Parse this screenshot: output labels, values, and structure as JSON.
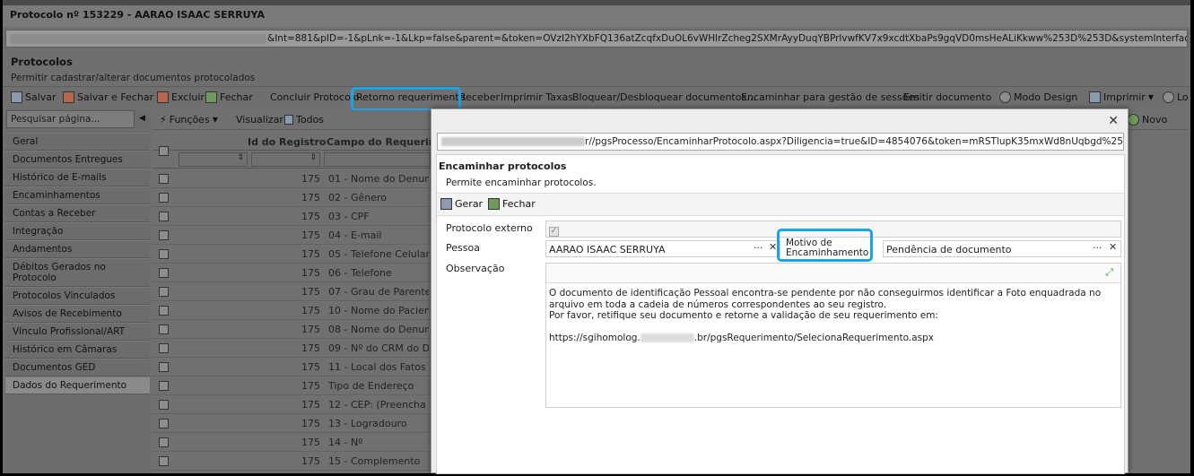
{
  "window": {
    "title": "Protocolo nº 153229 - AARAO ISAAC SERRUYA",
    "url_visible": "&Int=881&pID=-1&pLnk=-1&Lkp=false&parent=&token=OVzI2hYXbFQ136atZcqfxDuOL6vWHlrZcheg2SXMrAyyDuqYBPrlvwfKV7x9xcdtXbaPs9gqVD0msHeALiKkww%253D%253D&systemInterface=true&ID=485"
  },
  "header": {
    "title": "Protocolos",
    "subtitle": "Permitir cadastrar/alterar documentos protocolados"
  },
  "toolbar": {
    "items": [
      {
        "label": "Salvar",
        "icon": "save-icon"
      },
      {
        "label": "Salvar e Fechar",
        "icon": "save-close-icon"
      },
      {
        "label": "Excluir",
        "icon": "delete-icon"
      },
      {
        "label": "Fechar",
        "icon": "close-icon"
      },
      {
        "label": "Concluir Protocolo"
      },
      {
        "label": "Retorno requerimento"
      },
      {
        "label": "Receber"
      },
      {
        "label": "Imprimir Taxas"
      },
      {
        "label": "Bloquear/Desbloquear documentos..."
      },
      {
        "label": "Encaminhar para gestão de sessões"
      },
      {
        "label": "Emitir documento"
      },
      {
        "label": "Modo Design",
        "icon": "gear-icon"
      },
      {
        "label": "Imprimir",
        "icon": "printer-icon"
      },
      {
        "label": "Lo"
      }
    ]
  },
  "sidebar": {
    "search_placeholder": "Pesquisar página...",
    "items": [
      {
        "label": "Geral"
      },
      {
        "label": "Documentos Entregues"
      },
      {
        "label": "Histórico de E-mails"
      },
      {
        "label": "Encaminhamentos"
      },
      {
        "label": "Contas a Receber"
      },
      {
        "label": "Integração"
      },
      {
        "label": "Andamentos"
      },
      {
        "label": "Débitos Gerados no Protocolo"
      },
      {
        "label": "Protocolos Vinculados"
      },
      {
        "label": "Avisos de Recebimento"
      },
      {
        "label": "Vínculo Profissional/ART"
      },
      {
        "label": "Histórico em Câmaras"
      },
      {
        "label": "Documentos GED"
      },
      {
        "label": "Dados do Requerimento",
        "selected": true
      }
    ]
  },
  "grid_toolbar": {
    "funcoes": "Funções",
    "visualizar": "Visualizar",
    "todos": "Todos",
    "novo": "Novo"
  },
  "grid": {
    "columns": [
      "Id do Registro",
      "Campo do Requerime"
    ],
    "rows": [
      {
        "id": "175",
        "campo": "01 - Nome do Denuncia"
      },
      {
        "id": "175",
        "campo": "02 - Gênero"
      },
      {
        "id": "175",
        "campo": "03 - CPF"
      },
      {
        "id": "175",
        "campo": "04 - E-mail"
      },
      {
        "id": "175",
        "campo": "05 - Telefone Celular"
      },
      {
        "id": "175",
        "campo": "06 - Telefone"
      },
      {
        "id": "175",
        "campo": "07 - Grau de Parentesco"
      },
      {
        "id": "175",
        "campo": "10 - Nome do Paciente"
      },
      {
        "id": "175",
        "campo": "08 - Nome do Denuncia"
      },
      {
        "id": "175",
        "campo": "09 - Nº do CRM do Den"
      },
      {
        "id": "175",
        "campo": "11 - Local dos Fatos (Cl"
      },
      {
        "id": "175",
        "campo": "Tipo de Endereço"
      },
      {
        "id": "175",
        "campo": "12 - CEP: (Preencha Pri"
      },
      {
        "id": "175",
        "campo": "13 - Logradouro"
      },
      {
        "id": "175",
        "campo": "14 - Nº"
      },
      {
        "id": "175",
        "campo": "15 - Complemento"
      }
    ]
  },
  "dialog": {
    "url_visible": "r//pgsProcesso/EncaminharProtocolo.aspx?Diligencia=true&ID=4854076&token=mRSTlupK35mxWd8nUqbgd%2520zuT83k",
    "title": "Encaminhar protocolos",
    "subtitle": "Permite encaminhar protocolos.",
    "gerar": "Gerar",
    "fechar": "Fechar",
    "protocolo_externo_label": "Protocolo externo",
    "protocolo_externo_checked": true,
    "pessoa_label": "Pessoa",
    "pessoa_value": "AARAO ISAAC SERRUYA",
    "motivo_label": "Motivo de Encaminhamento",
    "motivo_value": "Pendência de documento",
    "observacao_label": "Observação",
    "obs_line1": "O documento de identificação Pessoal encontra-se pendente por não conseguirmos identificar a Foto enquadrada no arquivo em toda a cadeia de números correspondentes ao seu registro.",
    "obs_line2": "Por favor, retifique seu documento e retorne a validação de seu requerimento em:",
    "obs_link_prefix": "https://sgihomolog.",
    "obs_link_suffix": ".br/pgsRequerimento/SelecionaRequerimento.aspx"
  },
  "colors": {
    "highlight": "#1aa3e6"
  }
}
